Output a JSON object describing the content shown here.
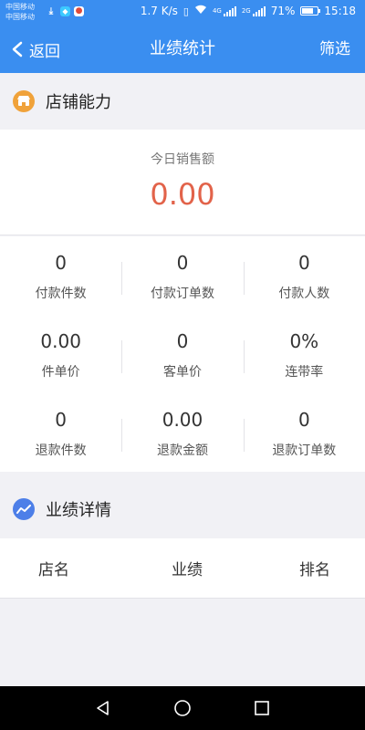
{
  "statusbar": {
    "carrier1": "中国移动",
    "carrier2": "中国移动",
    "speed": "1.7 K/s",
    "network1": "4G",
    "network2": "2G",
    "battery": "71%",
    "battery_level": 0.71,
    "time": "15:18"
  },
  "navbar": {
    "back_label": "返回",
    "title": "业绩统计",
    "filter_label": "筛选"
  },
  "store": {
    "section_title": "店铺能力",
    "today_label": "今日销售额",
    "today_value": "0.00",
    "metrics": [
      {
        "value": "0",
        "label": "付款件数"
      },
      {
        "value": "0",
        "label": "付款订单数"
      },
      {
        "value": "0",
        "label": "付款人数"
      },
      {
        "value": "0.00",
        "label": "件单价"
      },
      {
        "value": "0",
        "label": "客单价"
      },
      {
        "value": "0%",
        "label": "连带率"
      },
      {
        "value": "0",
        "label": "退款件数"
      },
      {
        "value": "0.00",
        "label": "退款金额"
      },
      {
        "value": "0",
        "label": "退款订单数"
      }
    ]
  },
  "detail": {
    "section_title": "业绩详情",
    "columns": [
      "店名",
      "业绩",
      "排名"
    ]
  },
  "colors": {
    "primary": "#3a8ef0",
    "accent_value": "#e2634a",
    "store_icon": "#f0a23a",
    "detail_icon": "#4d7fe8"
  },
  "icons": {
    "store": "store-icon",
    "detail": "trend-chart-icon",
    "back": "chevron-left-icon"
  }
}
